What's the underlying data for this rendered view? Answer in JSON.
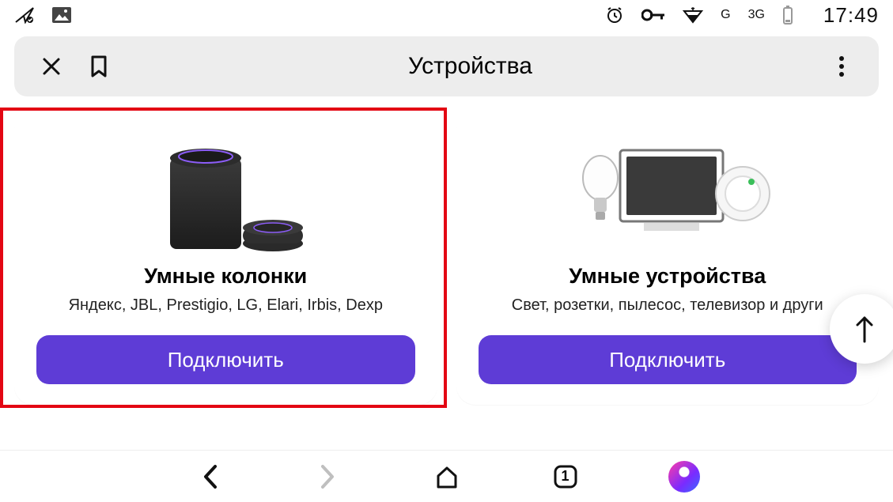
{
  "statusbar": {
    "net_g": "G",
    "net_3g": "3G",
    "time": "17:49"
  },
  "header": {
    "title": "Устройства"
  },
  "cards": [
    {
      "title": "Умные колонки",
      "subtitle": "Яндекс, JBL, Prestigio, LG, Elari, Irbis, Dexp",
      "button": "Подключить"
    },
    {
      "title": "Умные устройства",
      "subtitle": "Свет, розетки, пылесос, телевизор и други",
      "button": "Подключить"
    }
  ],
  "bottombar": {
    "tab_count": "1"
  },
  "colors": {
    "accent": "#5e3cd6",
    "highlight": "#e30613"
  }
}
